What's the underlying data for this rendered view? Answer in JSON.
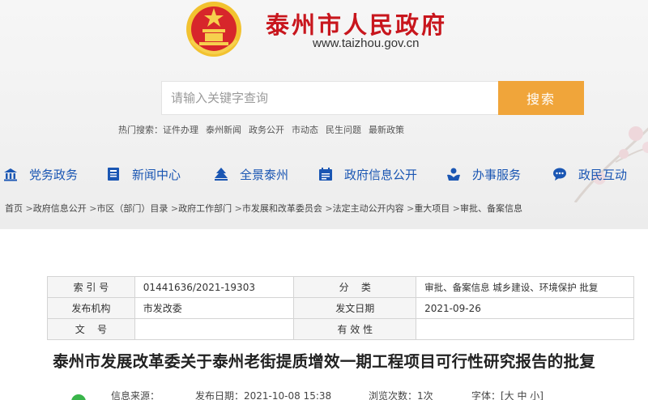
{
  "header": {
    "site_title": "泰州市人民政府",
    "site_url": "www.taizhou.gov.cn",
    "emblem_icon": "national-emblem-icon",
    "title_color": "#c8161d"
  },
  "search": {
    "placeholder": "请输入关键字查询",
    "button_label": "搜索",
    "button_color": "#f0a53a"
  },
  "hot_search": {
    "label": "热门搜索：",
    "items": [
      "证件办理",
      "泰州新闻",
      "政务公开",
      "市动态",
      "民生问题",
      "最新政策"
    ]
  },
  "nav": {
    "color": "#1a56b3",
    "items": [
      {
        "label": "党务政务",
        "icon": "building-icon"
      },
      {
        "label": "新闻中心",
        "icon": "newspaper-icon"
      },
      {
        "label": "全景泰州",
        "icon": "panorama-icon"
      },
      {
        "label": "政府信息公开",
        "icon": "calendar-icon"
      },
      {
        "label": "办事服务",
        "icon": "hands-icon"
      },
      {
        "label": "政民互动",
        "icon": "chat-icon"
      }
    ]
  },
  "breadcrumb": [
    "首页",
    "政府信息公开",
    "市区（部门）目录",
    "政府工作部门",
    "市发展和改革委员会",
    "法定主动公开内容",
    "重大项目",
    "审批、备案信息"
  ],
  "meta": {
    "index_label": "索 引 号",
    "index_value": "01441636/2021-19303",
    "category_label": "分    类",
    "category_value": "审批、备案信息 城乡建设、环境保护 批复",
    "publisher_label": "发布机构",
    "publisher_value": "市发改委",
    "issue_date_label": "发文日期",
    "issue_date_value": "2021-09-26",
    "doc_no_label": "文    号",
    "doc_no_value": "",
    "validity_label": "有 效 性",
    "validity_value": ""
  },
  "document": {
    "title": "泰州市发展改革委关于泰州老街提质增效一期工程项目可行性研究报告的批复"
  },
  "info_bar": {
    "source": "信息来源：",
    "publish_date": "发布日期：2021-10-08 15:38",
    "views": "浏览次数：1次",
    "font_size": "字体：[大 中 小]"
  }
}
